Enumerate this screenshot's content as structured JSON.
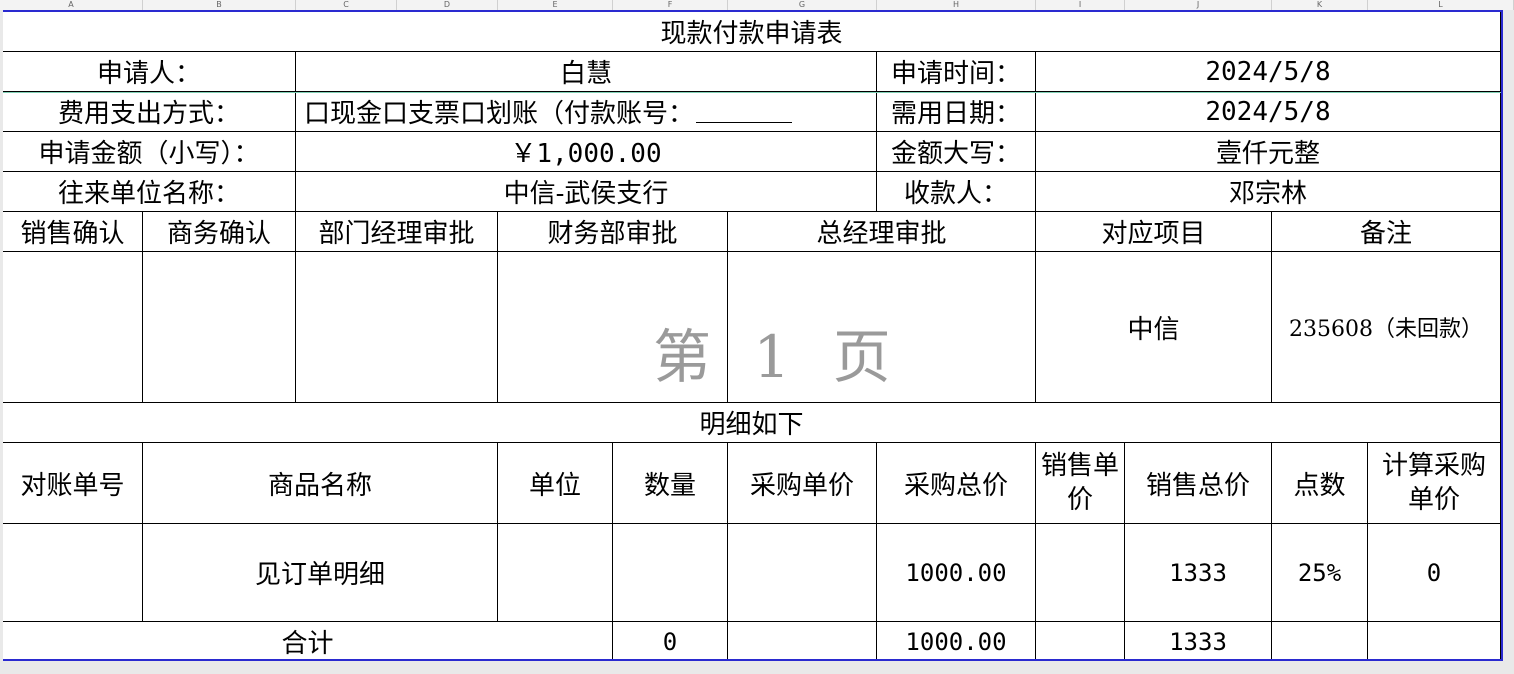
{
  "columns": [
    "A",
    "B",
    "C",
    "D",
    "E",
    "F",
    "G",
    "H",
    "I",
    "J",
    "K",
    "L"
  ],
  "form": {
    "title": "现款付款申请表",
    "applicant_label": "申请人：",
    "applicant_value": "白慧",
    "apply_time_label": "申请时间：",
    "apply_time_value": "2024/5/8",
    "payment_method_label": "费用支出方式：",
    "payment_method_value": "口现金口支票口划账（付款账号：",
    "need_date_label": "需用日期：",
    "need_date_value": "2024/5/8",
    "amount_label": "申请金额（小写）：",
    "amount_value": "￥1,000.00",
    "amount_upper_label": "金额大写：",
    "amount_upper_value": "壹仟元整",
    "partner_label": "往来单位名称：",
    "partner_value": "中信-武侯支行",
    "payee_label": "收款人：",
    "payee_value": "邓宗林"
  },
  "approval": {
    "headers": [
      "销售确认",
      "商务确认",
      "部门经理审批",
      "财务部审批",
      "总经理审批",
      "对应项目",
      "备注"
    ],
    "project_value": "中信",
    "remark_value": "235608（未回款）",
    "watermark": "第 1 页"
  },
  "details": {
    "heading": "明细如下",
    "headers": [
      "对账单号",
      "商品名称",
      "单位",
      "数量",
      "采购单价",
      "采购总价",
      "销售单价",
      "销售总价",
      "点数",
      "计算采购单价"
    ],
    "row": {
      "statement_no": "",
      "product_name": "见订单明细",
      "unit": "",
      "quantity": "",
      "purchase_unit_price": "",
      "purchase_total": "1000.00",
      "sale_unit_price": "",
      "sale_total": "1333",
      "points": "25%",
      "calc_purchase_unit_price": "0"
    },
    "total": {
      "label": "合计",
      "quantity": "0",
      "purchase_total": "1000.00",
      "sale_total": "1333"
    }
  }
}
